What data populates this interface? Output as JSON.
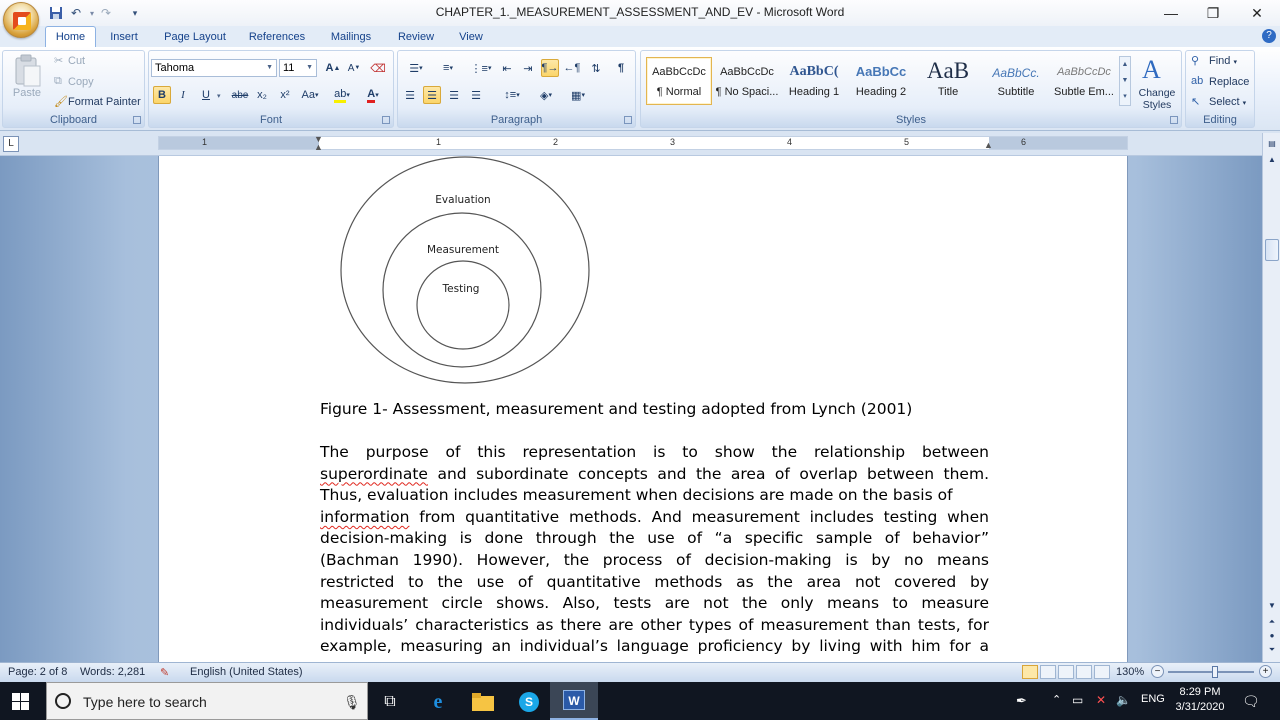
{
  "window": {
    "title": "CHAPTER_1._MEASUREMENT_ASSESSMENT_AND_EV - Microsoft Word",
    "controls": [
      "—",
      "❐",
      "✕"
    ]
  },
  "quick_access": {
    "save": "save-icon",
    "undo": "undo-icon",
    "redo": "redo-icon",
    "customize": "▾"
  },
  "tabs": [
    "Home",
    "Insert",
    "Page Layout",
    "References",
    "Mailings",
    "Review",
    "View"
  ],
  "ribbon": {
    "clipboard": {
      "paste": "Paste",
      "cut": "Cut",
      "copy": "Copy",
      "format_painter": "Format Painter",
      "label": "Clipboard"
    },
    "font": {
      "font_name": "Tahoma",
      "font_size": "11",
      "label": "Font",
      "bold": "B",
      "italic": "I",
      "underline": "U",
      "strike": "abe",
      "sub": "x₂",
      "sup": "x²",
      "case": "Aa",
      "grow": "A",
      "shrink": "A"
    },
    "paragraph": {
      "label": "Paragraph",
      "pilcrow": "¶"
    },
    "styles": {
      "label": "Styles",
      "items": [
        {
          "sample": "AaBbCcDc",
          "name": "¶ Normal"
        },
        {
          "sample": "AaBbCcDc",
          "name": "¶ No Spaci..."
        },
        {
          "sample": "AaBbC(",
          "name": "Heading 1"
        },
        {
          "sample": "AaBbCc",
          "name": "Heading 2"
        },
        {
          "sample": "AaB",
          "name": "Title"
        },
        {
          "sample": "AaBbCc.",
          "name": "Subtitle"
        },
        {
          "sample": "AaBbCcDc",
          "name": "Subtle Em..."
        }
      ],
      "change_styles": "Change Styles"
    },
    "editing": {
      "label": "Editing",
      "find": "Find",
      "replace": "Replace",
      "select": "Select"
    }
  },
  "ruler": {
    "numbers": [
      "1",
      "1",
      "2",
      "3",
      "4",
      "5",
      "6"
    ],
    "tab_selector": "L"
  },
  "document": {
    "diagram": {
      "outer": "Evaluation",
      "middle": "Measurement",
      "inner": "Testing"
    },
    "caption": "Figure 1- Assessment, measurement and testing adopted from Lynch (2001)",
    "paragraph_lines": [
      "The purpose of this representation is to show the relationship between",
      "superordinate and subordinate concepts and the area of overlap between them.",
      "Thus, evaluation includes measurement when decisions are made on the basis of",
      "information from quantitative methods. And measurement includes testing when",
      "decision-making is done through the use of “a specific sample of behavior”",
      "(Bachman 1990). However, the process of decision-making is by no means",
      "restricted to the use of quantitative methods as the area not covered by",
      "measurement circle shows. Also, tests are not the only means to measure",
      "individuals’ characteristics as there are other types of measurement than tests, for",
      "example, measuring an individual’s language proficiency by living with him for a"
    ],
    "spell_flagged": [
      "superordinate",
      "information"
    ]
  },
  "status": {
    "page": "Page: 2 of 8",
    "words": "Words: 2,281",
    "language": "English (United States)",
    "zoom": "130%",
    "zoom_level": 0.55
  },
  "taskbar": {
    "search_placeholder": "Type here to search",
    "lang": "ENG",
    "time": "8:29 PM",
    "date": "3/31/2020"
  }
}
